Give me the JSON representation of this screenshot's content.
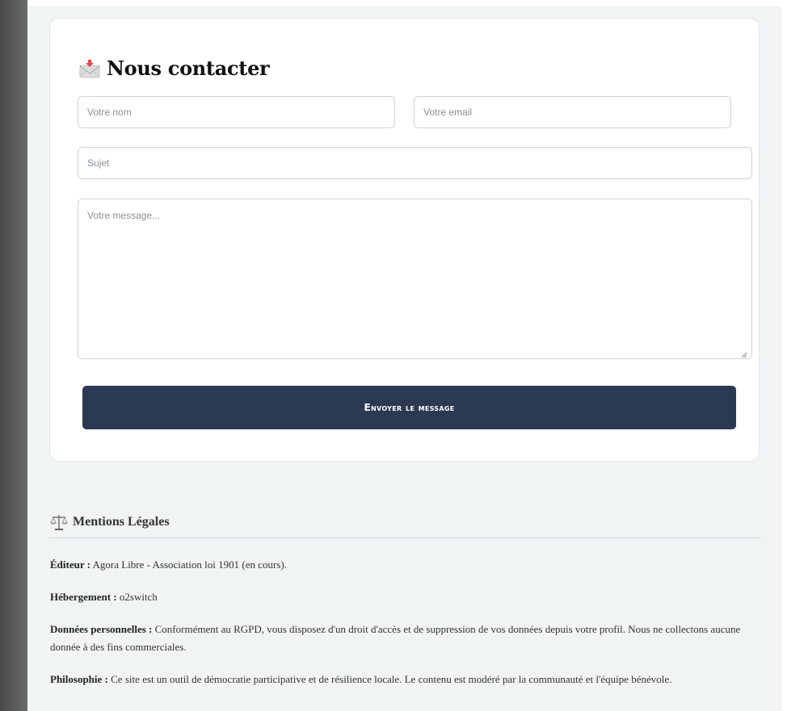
{
  "contact": {
    "title": "Nous contacter",
    "name_placeholder": "Votre nom",
    "email_placeholder": "Votre email",
    "subject_placeholder": "Sujet",
    "message_placeholder": "Votre message...",
    "send_label": "Envoyer le message"
  },
  "legal": {
    "title": "Mentions Légales",
    "items": [
      {
        "label": "Éditeur :",
        "text": "Agora Libre - Association loi 1901 (en cours)."
      },
      {
        "label": "Hébergement :",
        "text": "o2switch"
      },
      {
        "label": "Données personnelles :",
        "text": "Conformément au RGPD, vous disposez d'un droit d'accès et de suppression de vos données depuis votre profil. Nous ne collectons aucune donnée à des fins commerciales."
      },
      {
        "label": "Philosophie :",
        "text": "Ce site est un outil de démocratie participative et de résilience locale. Le contenu est modéré par la communauté et l'équipe bénévole."
      }
    ]
  },
  "colors": {
    "button": "#2b3a52",
    "background": "#f1f4f4",
    "card": "#ffffff"
  },
  "icons": {
    "contact": "envelope-icon",
    "legal": "scales-icon"
  }
}
